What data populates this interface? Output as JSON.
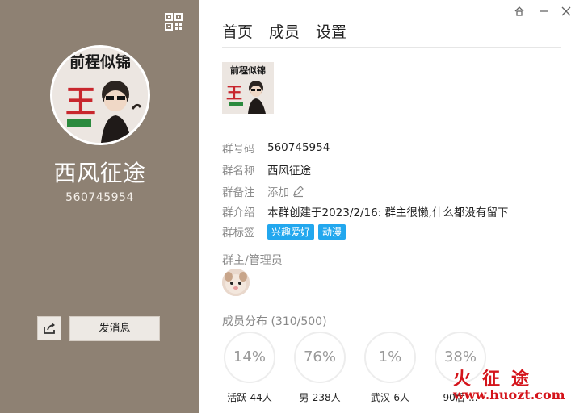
{
  "left_panel": {
    "group_name": "西风征途",
    "group_id": "560745954",
    "send_button_label": "发消息"
  },
  "tabs": [
    {
      "label": "首页",
      "active": true
    },
    {
      "label": "成员",
      "active": false
    },
    {
      "label": "设置",
      "active": false
    }
  ],
  "info": {
    "id_label": "群号码",
    "id_value": "560745954",
    "name_label": "群名称",
    "name_value": "西风征途",
    "remark_label": "群备注",
    "remark_action": "添加",
    "intro_label": "群介绍",
    "intro_value": "本群创建于2023/2/16:  群主很懒,什么都没有留下",
    "tags_label": "群标签",
    "tags": [
      "兴趣爱好",
      "动漫"
    ]
  },
  "admins_title": "群主/管理员",
  "distribution": {
    "title": "成员分布 (310/500)",
    "items": [
      {
        "percent": "14%",
        "label": "活跃-44人"
      },
      {
        "percent": "76%",
        "label": "男-238人"
      },
      {
        "percent": "1%",
        "label": "武汉-6人"
      },
      {
        "percent": "38%",
        "label": "90后-..."
      }
    ]
  },
  "watermark": {
    "title": "火征途",
    "url": "www.huozt.com"
  },
  "avatar_text": "前程似锦",
  "colors": {
    "left_bg": "#8e8173",
    "tag_bg": "#22a7ee",
    "watermark": "#d4141b"
  }
}
